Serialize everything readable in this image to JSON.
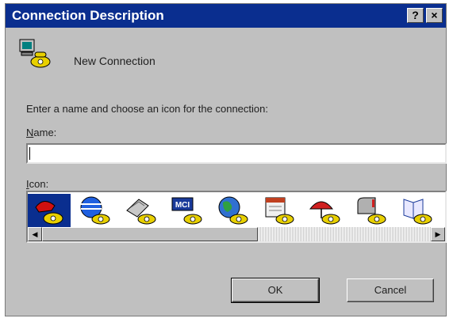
{
  "window": {
    "title": "Connection Description",
    "help_glyph": "?",
    "close_glyph": "×"
  },
  "header": {
    "icon": "network-computer-phone-icon",
    "connection_name": "New Connection"
  },
  "instruction": "Enter a name and choose an icon for the connection:",
  "name_field": {
    "label_accel": "N",
    "label_rest": "ame:",
    "value": "",
    "placeholder": ""
  },
  "icon_picker": {
    "label_accel": "I",
    "label_rest": "con:",
    "selected_index": 0,
    "icons": [
      "red-phone-icon",
      "globe-phone-icon",
      "fax-phone-icon",
      "mci-phone-icon",
      "earth-phone-icon",
      "calendar-phone-icon",
      "umbrella-phone-icon",
      "mailbox-phone-icon",
      "book-phone-icon"
    ],
    "mci_text": "MCI",
    "scroll_left_glyph": "◀",
    "scroll_right_glyph": "▶"
  },
  "buttons": {
    "ok_label": "OK",
    "cancel_label": "Cancel"
  },
  "colors": {
    "titlebar": "#0a2e8f",
    "dialog_face": "#c0c0c0",
    "phone_yellow": "#e8d000"
  }
}
